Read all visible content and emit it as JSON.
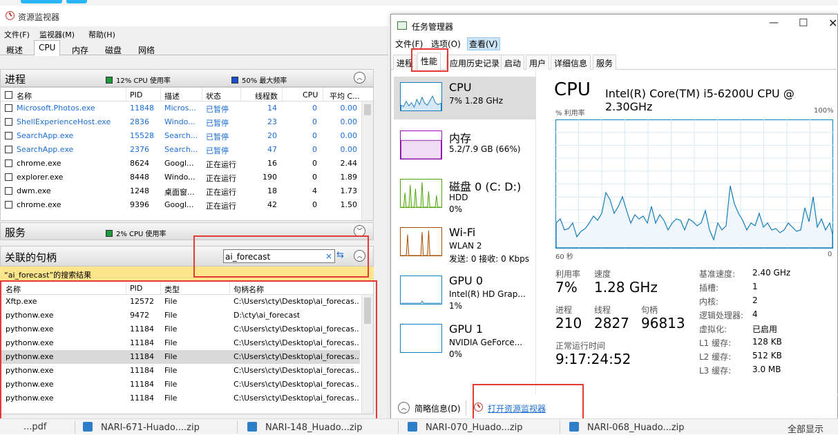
{
  "resmon": {
    "title": "资源监视器",
    "menu": [
      "文件(F)",
      "监视器(M)",
      "帮助(H)"
    ],
    "tabs": [
      "概述",
      "CPU",
      "内存",
      "磁盘",
      "网络"
    ],
    "processes": {
      "header": "进程",
      "cpu_usage": "12% CPU 使用率",
      "max_freq": "50% 最大频率",
      "columns": [
        "名称",
        "PID",
        "描述",
        "状态",
        "线程数",
        "CPU",
        "平均 C..."
      ],
      "rows": [
        {
          "name": "Microsoft.Photos.exe",
          "pid": "11848",
          "desc": "Micros...",
          "status": "已暂停",
          "threads": "14",
          "cpu": "0",
          "avg": "0.00",
          "suspended": true
        },
        {
          "name": "ShellExperienceHost.exe",
          "pid": "2836",
          "desc": "Windo...",
          "status": "已暂停",
          "threads": "23",
          "cpu": "0",
          "avg": "0.00",
          "suspended": true
        },
        {
          "name": "SearchApp.exe",
          "pid": "15528",
          "desc": "Search...",
          "status": "已暂停",
          "threads": "20",
          "cpu": "0",
          "avg": "0.00",
          "suspended": true
        },
        {
          "name": "SearchApp.exe",
          "pid": "2376",
          "desc": "Search...",
          "status": "已暂停",
          "threads": "47",
          "cpu": "0",
          "avg": "0.00",
          "suspended": true
        },
        {
          "name": "chrome.exe",
          "pid": "8624",
          "desc": "Googl...",
          "status": "正在运行",
          "threads": "16",
          "cpu": "0",
          "avg": "2.44",
          "suspended": false
        },
        {
          "name": "explorer.exe",
          "pid": "8448",
          "desc": "Windo...",
          "status": "正在运行",
          "threads": "190",
          "cpu": "0",
          "avg": "1.89",
          "suspended": false
        },
        {
          "name": "dwm.exe",
          "pid": "1248",
          "desc": "桌面窗...",
          "status": "正在运行",
          "threads": "18",
          "cpu": "4",
          "avg": "1.73",
          "suspended": false
        },
        {
          "name": "chrome.exe",
          "pid": "9396",
          "desc": "Googl...",
          "status": "正在运行",
          "threads": "42",
          "cpu": "0",
          "avg": "1.50",
          "suspended": false
        }
      ]
    },
    "services": {
      "header": "服务",
      "cpu_usage": "2% CPU 使用率"
    },
    "handles": {
      "header": "关联的句柄",
      "search_value": "ai_forecast",
      "result_label": "“ai_forecast”的搜索结果",
      "columns": [
        "名称",
        "PID",
        "类型",
        "句柄名称"
      ],
      "rows": [
        {
          "name": "Xftp.exe",
          "pid": "12572",
          "type": "File",
          "handle": "C:\\Users\\cty\\Desktop\\ai_forecas..."
        },
        {
          "name": "pythonw.exe",
          "pid": "9472",
          "type": "File",
          "handle": "D:\\cty\\ai_forecast"
        },
        {
          "name": "pythonw.exe",
          "pid": "11184",
          "type": "File",
          "handle": "C:\\Users\\cty\\Desktop\\ai_forecas..."
        },
        {
          "name": "pythonw.exe",
          "pid": "11184",
          "type": "File",
          "handle": "C:\\Users\\cty\\Desktop\\ai_forecas..."
        },
        {
          "name": "pythonw.exe",
          "pid": "11184",
          "type": "File",
          "handle": "C:\\Users\\cty\\Desktop\\ai_forecas..."
        },
        {
          "name": "pythonw.exe",
          "pid": "11184",
          "type": "File",
          "handle": "C:\\Users\\cty\\Desktop\\ai_forecas..."
        },
        {
          "name": "pythonw.exe",
          "pid": "11184",
          "type": "File",
          "handle": "C:\\Users\\cty\\Desktop\\ai_forecas..."
        },
        {
          "name": "pythonw.exe",
          "pid": "11184",
          "type": "File",
          "handle": "C:\\Users\\cty\\Desktop\\ai_forecas..."
        }
      ]
    }
  },
  "taskmgr": {
    "title": "任务管理器",
    "menu": [
      "文件(F)",
      "选项(O)",
      "查看(V)"
    ],
    "tabs": [
      "进程",
      "性能",
      "应用历史记录",
      "启动",
      "用户",
      "详细信息",
      "服务"
    ],
    "sidebar": [
      {
        "name": "CPU",
        "sub1": "7% 1.28 GHz",
        "sub2": "",
        "color": "#117dbb"
      },
      {
        "name": "内存",
        "sub1": "5.2/7.9 GB (66%)",
        "sub2": "",
        "color": "#8b12ae"
      },
      {
        "name": "磁盘 0 (C: D:)",
        "sub1": "HDD",
        "sub2": "0%",
        "color": "#4da60c"
      },
      {
        "name": "Wi-Fi",
        "sub1": "WLAN 2",
        "sub2": "发送: 0 接收: 0 Kbps",
        "color": "#a74f01"
      },
      {
        "name": "GPU 0",
        "sub1": "Intel(R) HD Grap...",
        "sub2": "1%",
        "color": "#117dbb"
      },
      {
        "name": "GPU 1",
        "sub1": "NVIDIA GeForce...",
        "sub2": "0%",
        "color": "#117dbb"
      }
    ],
    "cpu": {
      "heading": "CPU",
      "model": "Intel(R) Core(TM) i5-6200U CPU @ 2.30GHz",
      "graph_label": "% 利用率",
      "graph_max": "100%",
      "axis_left": "60 秒",
      "axis_right": "0",
      "utilization_label": "利用率",
      "utilization": "7%",
      "speed_label": "速度",
      "speed": "1.28 GHz",
      "processes_label": "进程",
      "processes": "210",
      "threads_label": "线程",
      "threads": "2827",
      "handles_label": "句柄",
      "handles": "96813",
      "uptime_label": "正常运行时间",
      "uptime": "9:17:24:52",
      "specs": [
        {
          "k": "基准速度:",
          "v": "2.40 GHz"
        },
        {
          "k": "插槽:",
          "v": "1"
        },
        {
          "k": "内核:",
          "v": "2"
        },
        {
          "k": "逻辑处理器:",
          "v": "4"
        },
        {
          "k": "虚拟化:",
          "v": "已启用"
        },
        {
          "k": "L1 缓存:",
          "v": "128 KB"
        },
        {
          "k": "L2 缓存:",
          "v": "512 KB"
        },
        {
          "k": "L3 缓存:",
          "v": "3.0 MB"
        }
      ],
      "accent": "#117dbb"
    },
    "footer": {
      "brief": "简略信息(D)",
      "open_resmon": "打开资源监视器"
    }
  },
  "taskbar": {
    "items": [
      "...pdf",
      "NARI-671-Huado....zip",
      "NARI-148_Huado...zip",
      "NARI-070_Huado...zip",
      "NARI-068_Huado...zip",
      "全部显示"
    ]
  }
}
